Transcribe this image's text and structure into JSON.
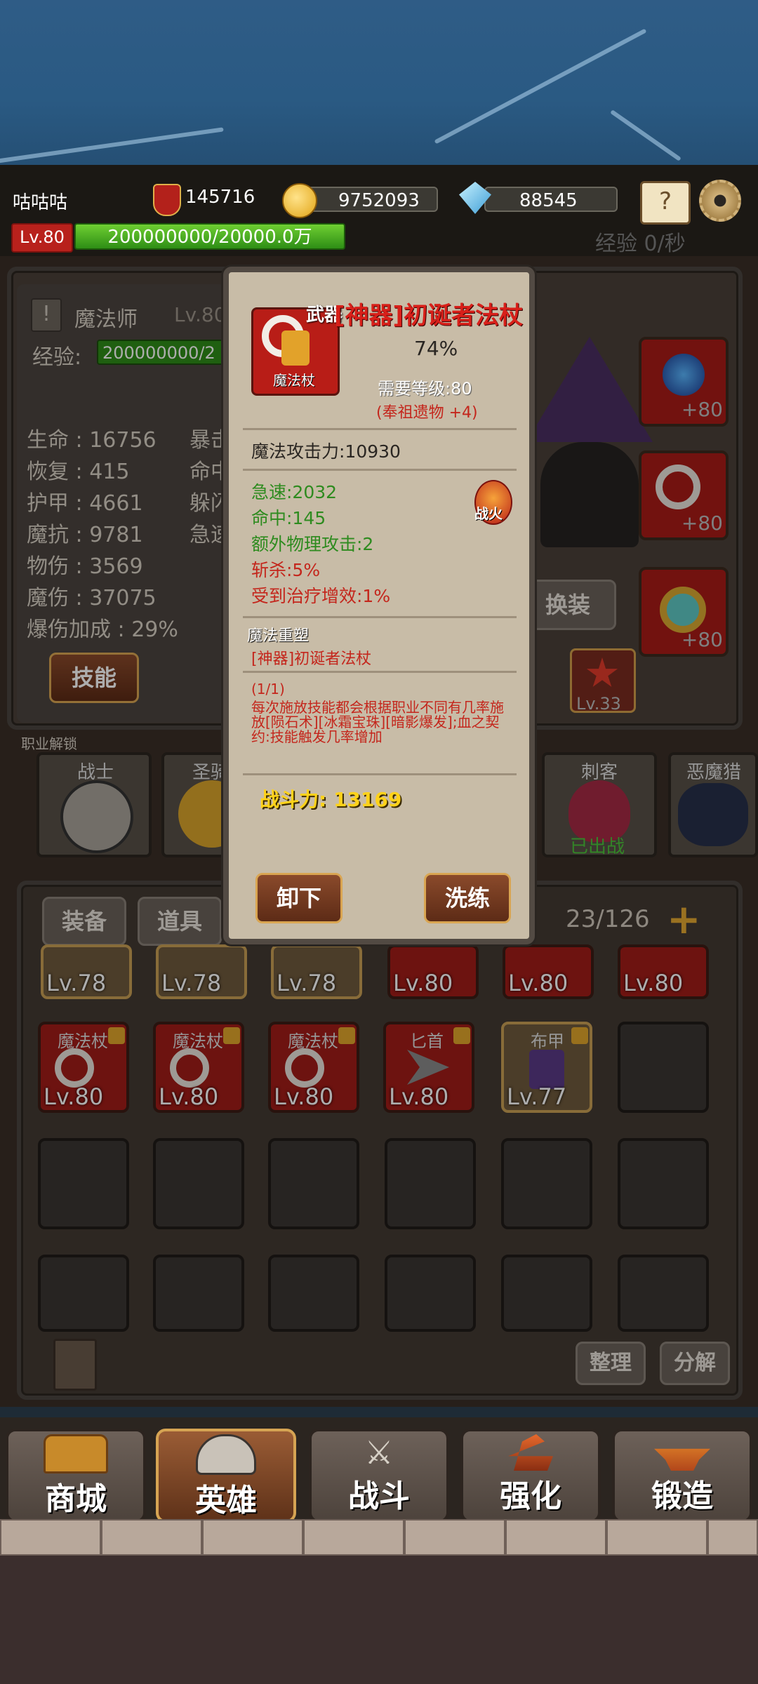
{
  "header": {
    "player_name": "咕咕咕",
    "power": "145716",
    "gold": "9752093",
    "diamonds": "88545",
    "level": "Lv.80",
    "exp": "200000000/20000.0万",
    "exp_rate": "经验 0/秒"
  },
  "hero": {
    "class_name": "魔法师",
    "level": "Lv.80",
    "exp_label": "经验:",
    "exp_value": "200000000/2",
    "stats": [
      {
        "label": "生命",
        "value": "16756"
      },
      {
        "label": "恢复",
        "value": "415"
      },
      {
        "label": "护甲",
        "value": "4661"
      },
      {
        "label": "魔抗",
        "value": "9781"
      },
      {
        "label": "物伤",
        "value": "3569"
      },
      {
        "label": "魔伤",
        "value": "37075"
      },
      {
        "label": "爆伤加成",
        "value": "29%"
      }
    ],
    "stats_right_partial": [
      "暴击",
      "命中",
      "躲闪",
      "急速"
    ],
    "skill_button": "技能",
    "swap_button": "换装",
    "equip_plus": [
      "+80",
      "+80",
      "+80"
    ],
    "medal_level": "Lv.33"
  },
  "classes": {
    "header": "职业解锁",
    "items": [
      {
        "label": "战士"
      },
      {
        "label": "圣骑"
      },
      {
        "label": "刺客",
        "status": "已出战"
      },
      {
        "label": "恶魔猎"
      }
    ]
  },
  "inventory": {
    "tabs": [
      "装备",
      "道具"
    ],
    "capacity": "23/126",
    "row1_levels": [
      "Lv.78",
      "Lv.78",
      "Lv.78",
      "Lv.80",
      "Lv.80",
      "Lv.80"
    ],
    "row2": [
      {
        "name": "魔法杖",
        "level": "Lv.80"
      },
      {
        "name": "魔法杖",
        "level": "Lv.80"
      },
      {
        "name": "魔法杖",
        "level": "Lv.80"
      },
      {
        "name": "匕首",
        "level": "Lv.80"
      },
      {
        "name": "布甲",
        "level": "Lv.77"
      }
    ],
    "sort_button": "整理",
    "decompose_button": "分解"
  },
  "popup": {
    "slot_type": "武器",
    "item_name": "[神器]初诞者法杖",
    "item_icon_label": "魔法杖",
    "quality": "74%",
    "required_level": "需要等级:80",
    "refine": "(奉祖遗物 +4)",
    "main_stat": "魔法攻击力:10930",
    "green_stats": [
      "急速:2032",
      "命中:145",
      "额外物理攻击:2"
    ],
    "red_stats": [
      "斩杀:5%",
      "受到治疗增效:1%"
    ],
    "fire_badge": "战火",
    "reforge_title": "魔法重塑",
    "reforge_item": "[神器]初诞者法杖",
    "set_count": "(1/1)",
    "set_desc": "每次施放技能都会根据职业不同有几率施放[陨石术][冰霜宝珠][暗影爆发];血之契约:技能触发几率增加",
    "combat_power": "战斗力: 13169",
    "unequip_button": "卸下",
    "reroll_button": "洗练"
  },
  "nav": {
    "items": [
      {
        "label": "商城",
        "active": false
      },
      {
        "label": "英雄",
        "active": true
      },
      {
        "label": "战斗",
        "active": false
      },
      {
        "label": "强化",
        "active": false
      },
      {
        "label": "锻造",
        "active": false
      }
    ]
  }
}
